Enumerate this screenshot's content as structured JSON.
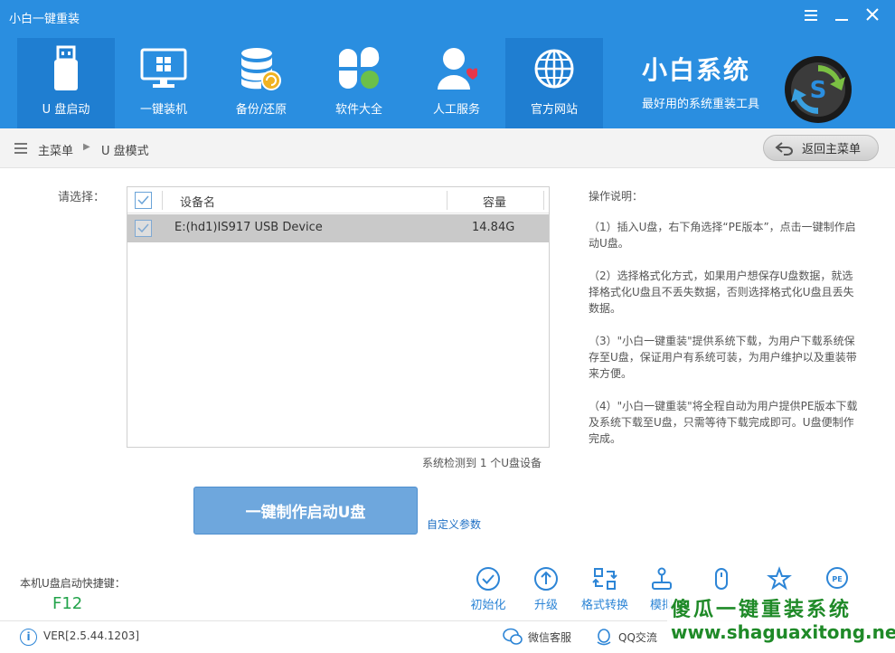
{
  "window": {
    "title": "小白一键重装",
    "minimize_icon": "minimize-icon",
    "close_icon": "close-icon",
    "menu_icon": "menu-icon"
  },
  "nav": {
    "items": [
      {
        "label": "U 盘启动",
        "icon": "usb-drive-icon",
        "active": true
      },
      {
        "label": "一键装机",
        "icon": "monitor-windows-icon"
      },
      {
        "label": "备份/还原",
        "icon": "database-backup-icon"
      },
      {
        "label": "软件大全",
        "icon": "apps-grid-icon"
      },
      {
        "label": "人工服务",
        "icon": "person-heart-icon"
      },
      {
        "label": "官方网站",
        "icon": "globe-icon"
      }
    ]
  },
  "brand": {
    "name": "小白系统",
    "slogan": "最好用的系统重装工具"
  },
  "breadcrumb": {
    "home": "主菜单",
    "current": "U 盘模式",
    "back_label": "返回主菜单"
  },
  "device_table": {
    "select_label": "请选择：",
    "headers": {
      "name": "设备名",
      "size": "容量"
    },
    "rows": [
      {
        "name": "E:(hd1)IS917 USB Device",
        "size": "14.84G",
        "checked": true
      }
    ],
    "detect_text": "系统检测到 1 个U盘设备"
  },
  "help": {
    "title": "操作说明：",
    "steps": [
      "（1）插入U盘，右下角选择“PE版本”，点击一键制作启动U盘。",
      "（2）选择格式化方式，如果用户想保存U盘数据，就选择格式化U盘且不丢失数据，否则选择格式化U盘且丢失数据。",
      "（3）\"小白一键重装\"提供系统下载，为用户下载系统保存至U盘，保证用户有系统可装，为用户维护以及重装带来方便。",
      "（4）\"小白一键重装\"将全程自动为用户提供PE版本下载及系统下载至U盘，只需等待下载完成即可。U盘便制作完成。"
    ]
  },
  "actions": {
    "make_label": "一键制作启动U盘",
    "custom_label": "自定义参数"
  },
  "hotkey": {
    "label": "本机U盘启动快捷键：",
    "value": "F12"
  },
  "tools": [
    {
      "label": "初始化",
      "icon": "check-circle-icon"
    },
    {
      "label": "升级",
      "icon": "upload-circle-icon"
    },
    {
      "label": "格式转换",
      "icon": "convert-icon"
    },
    {
      "label": "模拟",
      "icon": "joystick-icon"
    },
    {
      "label": "",
      "icon": "mouse-icon"
    },
    {
      "label": "",
      "icon": "star-icon"
    },
    {
      "label": "",
      "icon": "pe-icon"
    }
  ],
  "status": {
    "version": "VER[2.5.44.1203]",
    "wechat": "微信客服",
    "qq": "QQ交流"
  },
  "watermark": {
    "cn": "傻瓜一键重装系统",
    "url": "www.shaguaxitong.net"
  },
  "colors": {
    "header": "#2a8ee0",
    "header_active": "#1f7ed1",
    "link": "#1e6fc4",
    "button": "#6ea7dd",
    "hotkey": "#22a34a",
    "watermark": "#1f8a28"
  }
}
